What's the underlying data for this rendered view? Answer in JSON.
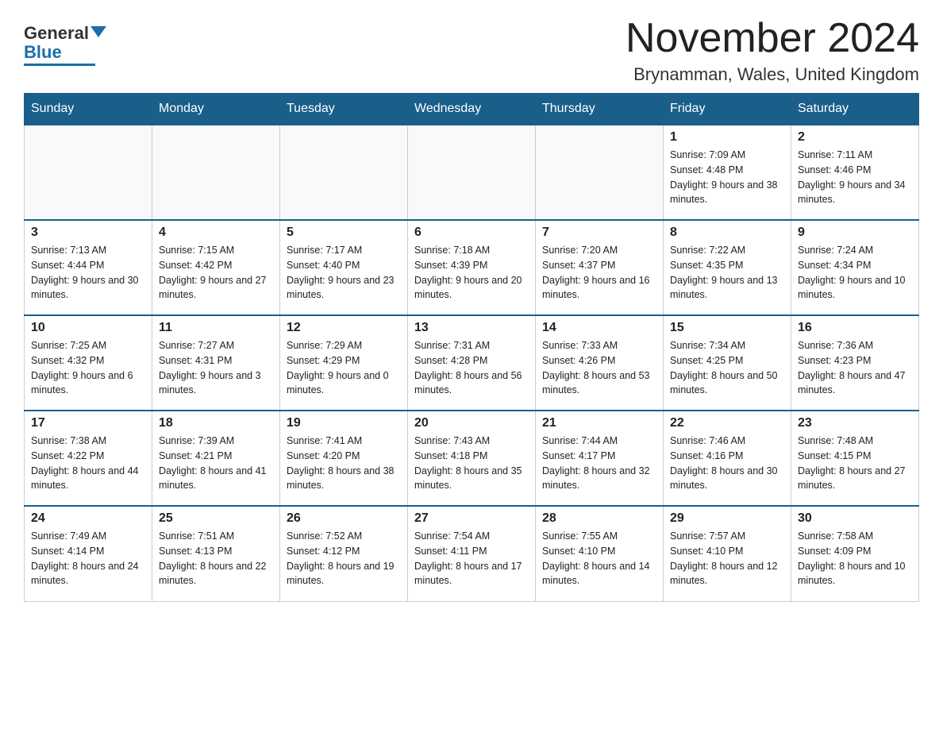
{
  "header": {
    "logo_general": "General",
    "logo_blue": "Blue",
    "month_title": "November 2024",
    "location": "Brynamman, Wales, United Kingdom"
  },
  "days_of_week": [
    "Sunday",
    "Monday",
    "Tuesday",
    "Wednesday",
    "Thursday",
    "Friday",
    "Saturday"
  ],
  "weeks": [
    [
      {
        "day": "",
        "info": ""
      },
      {
        "day": "",
        "info": ""
      },
      {
        "day": "",
        "info": ""
      },
      {
        "day": "",
        "info": ""
      },
      {
        "day": "",
        "info": ""
      },
      {
        "day": "1",
        "info": "Sunrise: 7:09 AM\nSunset: 4:48 PM\nDaylight: 9 hours and 38 minutes."
      },
      {
        "day": "2",
        "info": "Sunrise: 7:11 AM\nSunset: 4:46 PM\nDaylight: 9 hours and 34 minutes."
      }
    ],
    [
      {
        "day": "3",
        "info": "Sunrise: 7:13 AM\nSunset: 4:44 PM\nDaylight: 9 hours and 30 minutes."
      },
      {
        "day": "4",
        "info": "Sunrise: 7:15 AM\nSunset: 4:42 PM\nDaylight: 9 hours and 27 minutes."
      },
      {
        "day": "5",
        "info": "Sunrise: 7:17 AM\nSunset: 4:40 PM\nDaylight: 9 hours and 23 minutes."
      },
      {
        "day": "6",
        "info": "Sunrise: 7:18 AM\nSunset: 4:39 PM\nDaylight: 9 hours and 20 minutes."
      },
      {
        "day": "7",
        "info": "Sunrise: 7:20 AM\nSunset: 4:37 PM\nDaylight: 9 hours and 16 minutes."
      },
      {
        "day": "8",
        "info": "Sunrise: 7:22 AM\nSunset: 4:35 PM\nDaylight: 9 hours and 13 minutes."
      },
      {
        "day": "9",
        "info": "Sunrise: 7:24 AM\nSunset: 4:34 PM\nDaylight: 9 hours and 10 minutes."
      }
    ],
    [
      {
        "day": "10",
        "info": "Sunrise: 7:25 AM\nSunset: 4:32 PM\nDaylight: 9 hours and 6 minutes."
      },
      {
        "day": "11",
        "info": "Sunrise: 7:27 AM\nSunset: 4:31 PM\nDaylight: 9 hours and 3 minutes."
      },
      {
        "day": "12",
        "info": "Sunrise: 7:29 AM\nSunset: 4:29 PM\nDaylight: 9 hours and 0 minutes."
      },
      {
        "day": "13",
        "info": "Sunrise: 7:31 AM\nSunset: 4:28 PM\nDaylight: 8 hours and 56 minutes."
      },
      {
        "day": "14",
        "info": "Sunrise: 7:33 AM\nSunset: 4:26 PM\nDaylight: 8 hours and 53 minutes."
      },
      {
        "day": "15",
        "info": "Sunrise: 7:34 AM\nSunset: 4:25 PM\nDaylight: 8 hours and 50 minutes."
      },
      {
        "day": "16",
        "info": "Sunrise: 7:36 AM\nSunset: 4:23 PM\nDaylight: 8 hours and 47 minutes."
      }
    ],
    [
      {
        "day": "17",
        "info": "Sunrise: 7:38 AM\nSunset: 4:22 PM\nDaylight: 8 hours and 44 minutes."
      },
      {
        "day": "18",
        "info": "Sunrise: 7:39 AM\nSunset: 4:21 PM\nDaylight: 8 hours and 41 minutes."
      },
      {
        "day": "19",
        "info": "Sunrise: 7:41 AM\nSunset: 4:20 PM\nDaylight: 8 hours and 38 minutes."
      },
      {
        "day": "20",
        "info": "Sunrise: 7:43 AM\nSunset: 4:18 PM\nDaylight: 8 hours and 35 minutes."
      },
      {
        "day": "21",
        "info": "Sunrise: 7:44 AM\nSunset: 4:17 PM\nDaylight: 8 hours and 32 minutes."
      },
      {
        "day": "22",
        "info": "Sunrise: 7:46 AM\nSunset: 4:16 PM\nDaylight: 8 hours and 30 minutes."
      },
      {
        "day": "23",
        "info": "Sunrise: 7:48 AM\nSunset: 4:15 PM\nDaylight: 8 hours and 27 minutes."
      }
    ],
    [
      {
        "day": "24",
        "info": "Sunrise: 7:49 AM\nSunset: 4:14 PM\nDaylight: 8 hours and 24 minutes."
      },
      {
        "day": "25",
        "info": "Sunrise: 7:51 AM\nSunset: 4:13 PM\nDaylight: 8 hours and 22 minutes."
      },
      {
        "day": "26",
        "info": "Sunrise: 7:52 AM\nSunset: 4:12 PM\nDaylight: 8 hours and 19 minutes."
      },
      {
        "day": "27",
        "info": "Sunrise: 7:54 AM\nSunset: 4:11 PM\nDaylight: 8 hours and 17 minutes."
      },
      {
        "day": "28",
        "info": "Sunrise: 7:55 AM\nSunset: 4:10 PM\nDaylight: 8 hours and 14 minutes."
      },
      {
        "day": "29",
        "info": "Sunrise: 7:57 AM\nSunset: 4:10 PM\nDaylight: 8 hours and 12 minutes."
      },
      {
        "day": "30",
        "info": "Sunrise: 7:58 AM\nSunset: 4:09 PM\nDaylight: 8 hours and 10 minutes."
      }
    ]
  ]
}
